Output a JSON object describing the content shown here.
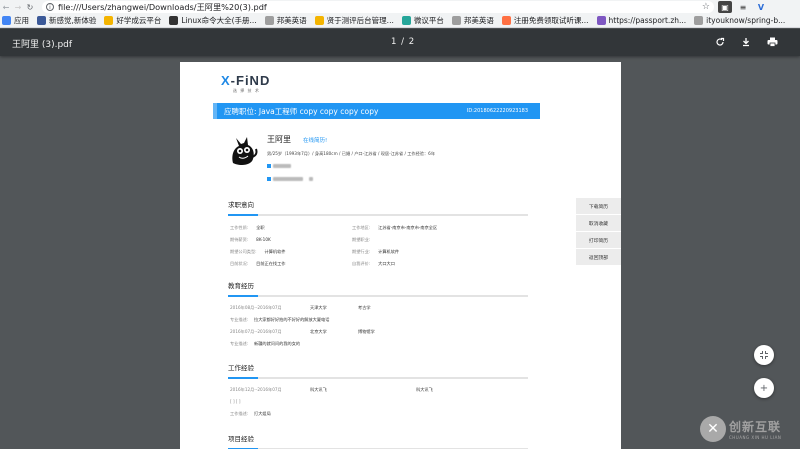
{
  "browser": {
    "url": "file:///Users/zhangwei/Downloads/王阿里%20(3).pdf",
    "bookmarks": [
      {
        "label": "应用",
        "icon": "apps-grid-icon",
        "color": "#4285f4"
      },
      {
        "label": "新感觉,新体验",
        "icon": "b-icon",
        "color": "#3b5998"
      },
      {
        "label": "好学成云平台",
        "icon": "doc-icon",
        "color": "#f4b400"
      },
      {
        "label": "Linux命令大全(手册...",
        "icon": "terminal-icon",
        "color": "#333333"
      },
      {
        "label": "邦美英语",
        "icon": "page-icon",
        "color": "#9e9e9e"
      },
      {
        "label": "贤于测评后台管理...",
        "icon": "doc-icon",
        "color": "#f4b400"
      },
      {
        "label": "微议平台",
        "icon": "v-icon",
        "color": "#26a69a"
      },
      {
        "label": "邦美英语",
        "icon": "page-icon",
        "color": "#9e9e9e"
      },
      {
        "label": "注册免费领取试听课...",
        "icon": "fire-icon",
        "color": "#ff7043"
      },
      {
        "label": "https://passport.zh...",
        "icon": "globe-icon",
        "color": "#7e57c2"
      },
      {
        "label": "ityouknow/spring-b...",
        "icon": "page-icon",
        "color": "#9e9e9e"
      }
    ]
  },
  "viewer": {
    "title": "王阿里 (3).pdf",
    "page_current": "1",
    "page_total": "2"
  },
  "resume": {
    "logo": "X-FiND",
    "logo_prefix": "X",
    "logo_rest": "-FiND",
    "logo_sub": "选 择 技 术",
    "position_label": "应聘职位:  Java工程师 copy copy copy copy",
    "resume_id": "ID:20180622220923183",
    "name": "王阿里",
    "online_link": "在线简历!",
    "meta": "男/25岁（1993年7月）/ 身高180cm / 已婚 / 户口-江苏省 / 现居-江苏省 / 工作经验：6年",
    "intention": {
      "heading": "求职意向",
      "rows": [
        {
          "label": "工作性质:",
          "value": "全职",
          "label2": "工作地区:",
          "value2": "江苏省-南京市-南京市-南京全区"
        },
        {
          "label": "期待薪资:",
          "value": "8K-10K",
          "label2": "期望职业:",
          "value2": ""
        },
        {
          "label": "期望公司类型:",
          "value": "计算机软件",
          "label2": "期望行业:",
          "value2": "计算机软件"
        },
        {
          "label": "目前状况:",
          "value": "目前正在找工作",
          "label2": "自我评价:",
          "value2": "大口大口"
        }
      ]
    },
    "education": {
      "heading": "教育经历",
      "items": [
        {
          "date": "2016年08月--2016年07月",
          "school": "天津大学",
          "major": "考古学",
          "desc_label": "专业描述:",
          "desc": "拉大家都好好拍的不好好的解放大厦电话"
        },
        {
          "date": "2016年07月--2016年07月",
          "school": "北京大学",
          "major": "博物馆学",
          "desc_label": "专业描述:",
          "desc": "新疆的就问问的我的女的"
        }
      ]
    },
    "work": {
      "heading": "工作经验",
      "items": [
        {
          "date": "2016年12月--2016年07月",
          "company": "科大讯飞",
          "company2": "科大讯飞",
          "note": "[ ] [ ]",
          "desc_label": "工作描述:",
          "desc": "打大姐局"
        }
      ]
    },
    "project": {
      "heading": "项目经验"
    }
  },
  "side_buttons": [
    "下载简历",
    "取消收藏",
    "打印简历",
    "返回顶部"
  ],
  "watermark": {
    "line1": "创新互联",
    "line2": "CHUANG XIN HU LIAN"
  }
}
